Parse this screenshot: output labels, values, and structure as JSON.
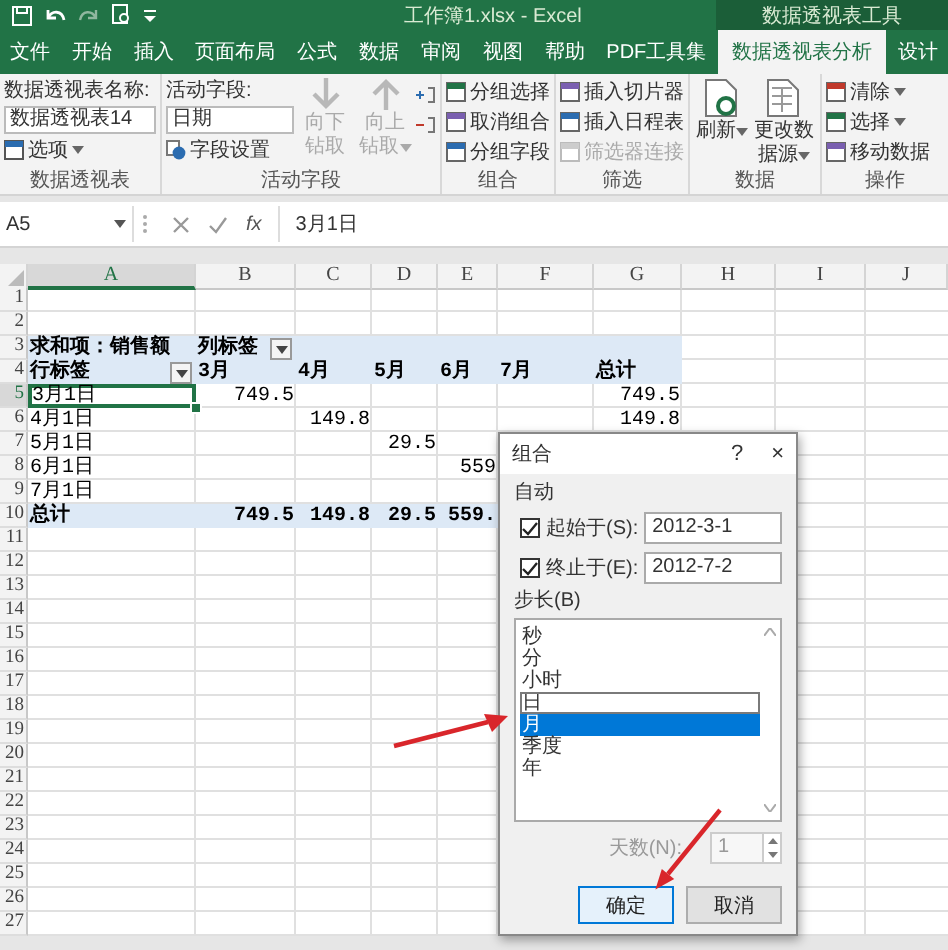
{
  "title_bar": {
    "title": "工作簿1.xlsx  -  Excel",
    "context": "数据透视表工具"
  },
  "tabs": [
    {
      "label": "文件",
      "selected": false
    },
    {
      "label": "开始",
      "selected": false
    },
    {
      "label": "插入",
      "selected": false
    },
    {
      "label": "页面布局",
      "selected": false
    },
    {
      "label": "公式",
      "selected": false
    },
    {
      "label": "数据",
      "selected": false
    },
    {
      "label": "审阅",
      "selected": false
    },
    {
      "label": "视图",
      "selected": false
    },
    {
      "label": "帮助",
      "selected": false
    },
    {
      "label": "PDF工具集",
      "selected": false
    },
    {
      "label": "数据透视表分析",
      "selected": true
    },
    {
      "label": "设计",
      "selected": false
    }
  ],
  "ribbon": {
    "groups": [
      {
        "kind": "pivot",
        "label": "数据透视表",
        "caption": "数据透视表名称:",
        "value": "数据透视表14",
        "button": "选项"
      },
      {
        "kind": "field",
        "label": "活动字段",
        "caption": "活动字段:",
        "value": "日期",
        "button": "字段设置",
        "drill": [
          {
            "label": "向下钻取",
            "disabled": true,
            "dropdown": false
          },
          {
            "label": "向上钻取",
            "disabled": true,
            "dropdown": true
          }
        ]
      },
      {
        "kind": "list",
        "label": "组合",
        "items": [
          {
            "label": "分组选择",
            "disabled": false,
            "dropdown": false
          },
          {
            "label": "取消组合",
            "disabled": false,
            "dropdown": false
          },
          {
            "label": "分组字段",
            "disabled": false,
            "dropdown": false
          }
        ]
      },
      {
        "kind": "list",
        "label": "筛选",
        "items": [
          {
            "label": "插入切片器",
            "disabled": false,
            "dropdown": false
          },
          {
            "label": "插入日程表",
            "disabled": false,
            "dropdown": false
          },
          {
            "label": "筛选器连接",
            "disabled": true,
            "dropdown": false
          }
        ]
      },
      {
        "kind": "big",
        "label": "数据",
        "items": [
          {
            "label": "刷新",
            "dropdown": true
          },
          {
            "label": "更改数据源",
            "dropdown": true
          }
        ]
      },
      {
        "kind": "list",
        "label": "操作",
        "items": [
          {
            "label": "清除",
            "disabled": false,
            "dropdown": true
          },
          {
            "label": "选择",
            "disabled": false,
            "dropdown": true
          },
          {
            "label": "移动数据",
            "disabled": false,
            "dropdown": false
          }
        ]
      }
    ]
  },
  "formula_bar": {
    "name_box": "A5",
    "function_glyph": "fx",
    "formula": "3月1日"
  },
  "sheet": {
    "columns": [
      "A",
      "B",
      "C",
      "D",
      "E",
      "F",
      "G",
      "H",
      "I",
      "J"
    ],
    "rows": [
      {
        "number": "1",
        "kind": "empty"
      },
      {
        "number": "2",
        "kind": "empty"
      },
      {
        "number": "3",
        "kind": "title",
        "cells": {
          "A": "求和项：销售额",
          "B": {
            "text": "列标签",
            "filter": true
          }
        }
      },
      {
        "number": "4",
        "kind": "header",
        "cells": {
          "A": {
            "text": "行标签",
            "filter": true
          },
          "B": "3月",
          "C": "4月",
          "D": "5月",
          "E": "6月",
          "F": "7月",
          "G": "总计"
        }
      },
      {
        "number": "5",
        "kind": "item",
        "cells": {
          "A": {
            "text": "3月1日",
            "selected": true
          },
          "B": "749.5",
          "G": "749.5"
        }
      },
      {
        "number": "6",
        "kind": "item",
        "cells": {
          "A": "4月1日",
          "C": "149.8",
          "G": "149.8"
        }
      },
      {
        "number": "7",
        "kind": "item",
        "cells": {
          "A": "5月1日",
          "D": "29.5"
        }
      },
      {
        "number": "8",
        "kind": "item",
        "cells": {
          "A": "6月1日",
          "E": "559"
        }
      },
      {
        "number": "9",
        "kind": "item",
        "cells": {
          "A": "7月1日"
        }
      },
      {
        "number": "10",
        "kind": "total",
        "cells": {
          "A": "总计",
          "B": "749.5",
          "C": "149.8",
          "D": "29.5",
          "E": "559."
        }
      },
      {
        "number": "11",
        "kind": "empty"
      },
      {
        "number": "12",
        "kind": "empty"
      },
      {
        "number": "13",
        "kind": "empty"
      },
      {
        "number": "14",
        "kind": "empty"
      },
      {
        "number": "15",
        "kind": "empty"
      },
      {
        "number": "16",
        "kind": "empty"
      },
      {
        "number": "17",
        "kind": "empty"
      },
      {
        "number": "18",
        "kind": "empty"
      },
      {
        "number": "19",
        "kind": "empty"
      },
      {
        "number": "20",
        "kind": "empty"
      },
      {
        "number": "21",
        "kind": "empty"
      },
      {
        "number": "22",
        "kind": "empty"
      },
      {
        "number": "23",
        "kind": "empty"
      },
      {
        "number": "24",
        "kind": "empty"
      },
      {
        "number": "25",
        "kind": "empty"
      },
      {
        "number": "26",
        "kind": "empty"
      },
      {
        "number": "27",
        "kind": "empty"
      }
    ]
  },
  "dialog": {
    "title": "组合",
    "help_glyph": "?",
    "close_glyph": "×",
    "section": "自动",
    "fields": [
      {
        "label": "起始于(S):",
        "checked": true,
        "value": "2012-3-1"
      },
      {
        "label": "终止于(E):",
        "checked": true,
        "value": "2012-7-2"
      }
    ],
    "step_label": "步长(B)",
    "steps": [
      {
        "label": "秒",
        "selected": false,
        "focused": false
      },
      {
        "label": "分",
        "selected": false,
        "focused": false
      },
      {
        "label": "小时",
        "selected": false,
        "focused": false
      },
      {
        "label": "日",
        "selected": false,
        "focused": true
      },
      {
        "label": "月",
        "selected": true,
        "focused": false
      },
      {
        "label": "季度",
        "selected": false,
        "focused": false
      },
      {
        "label": "年",
        "selected": false,
        "focused": false
      }
    ],
    "days": {
      "label": "天数(N):",
      "value": "1",
      "disabled": true
    },
    "buttons": [
      {
        "label": "确定",
        "default": true
      },
      {
        "label": "取消",
        "default": false
      }
    ]
  }
}
